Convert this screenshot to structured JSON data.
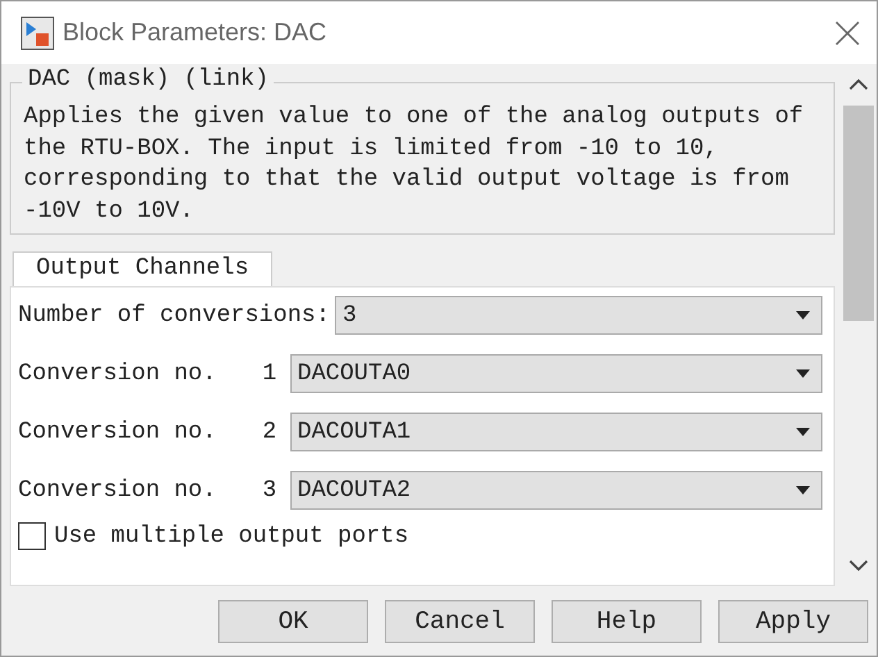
{
  "window": {
    "title": "Block Parameters: DAC"
  },
  "mask_group": {
    "title": "DAC (mask) (link)",
    "description": "Applies the given value to one of the analog outputs of the RTU-BOX. The input is limited from -10 to 10, corresponding to that the valid output voltage is from -10V to 10V."
  },
  "tabs": [
    {
      "label": "Output Channels",
      "selected": true
    }
  ],
  "fields": [
    {
      "kind": "count",
      "label": "Number of conversions:",
      "value": "3"
    },
    {
      "kind": "conversion",
      "label": "Conversion no.",
      "number": "1",
      "value": "DACOUTA0"
    },
    {
      "kind": "conversion",
      "label": "Conversion no.",
      "number": "2",
      "value": "DACOUTA1"
    },
    {
      "kind": "conversion",
      "label": "Conversion no.",
      "number": "3",
      "value": "DACOUTA2"
    }
  ],
  "checkbox": {
    "label": "Use multiple output ports",
    "checked": false
  },
  "buttons": [
    "OK",
    "Cancel",
    "Help",
    "Apply"
  ]
}
